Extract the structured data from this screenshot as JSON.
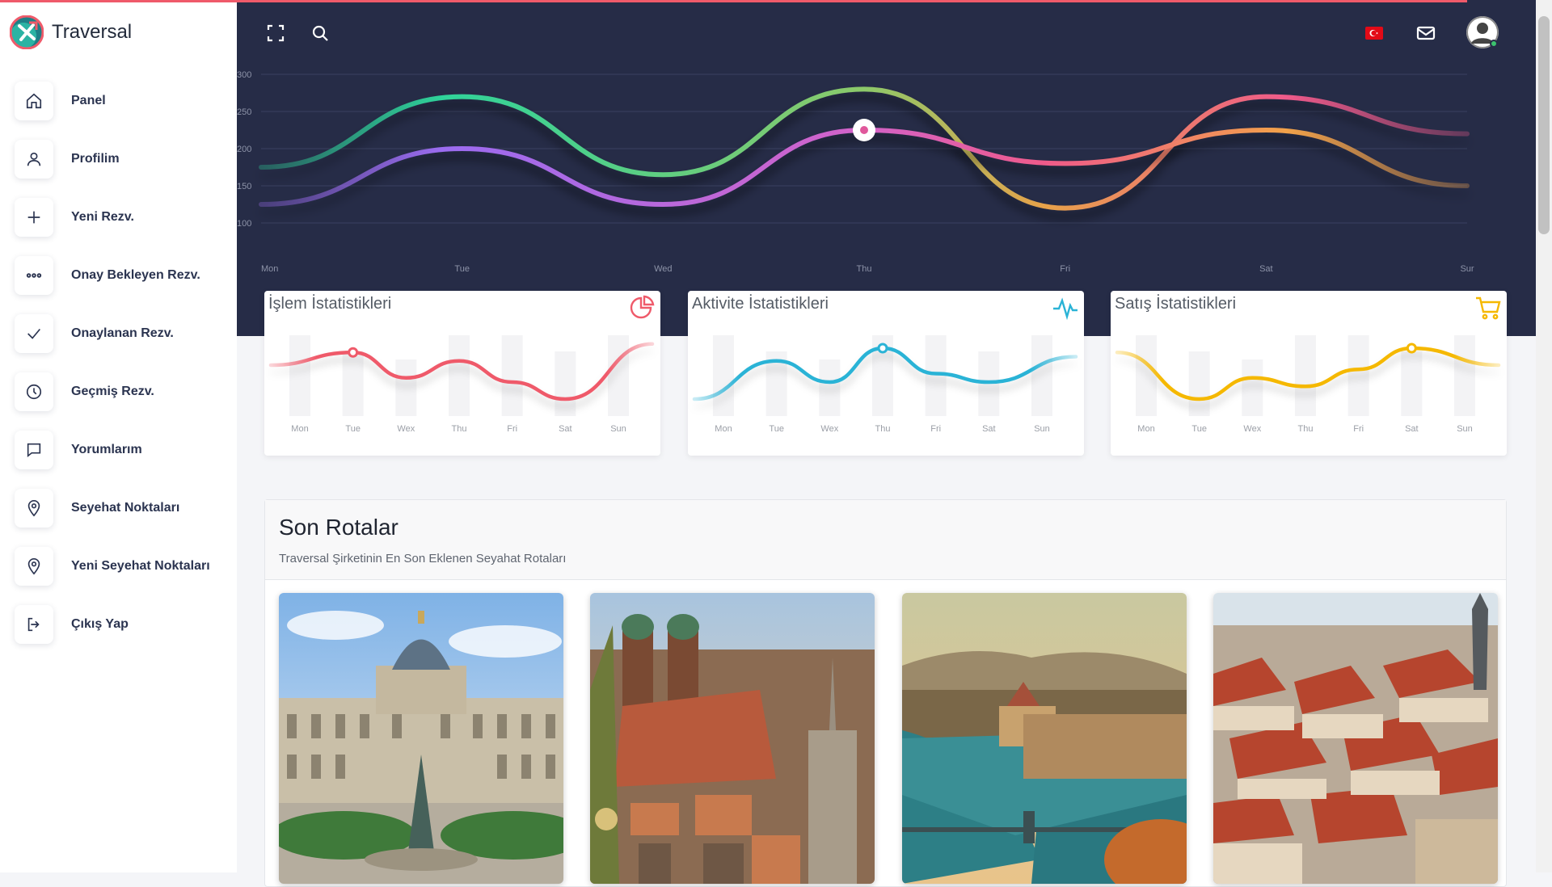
{
  "app": {
    "name": "Traversal"
  },
  "sidebar": {
    "items": [
      {
        "label": "Panel",
        "icon": "home-icon"
      },
      {
        "label": "Profilim",
        "icon": "user-icon"
      },
      {
        "label": "Yeni Rezv.",
        "icon": "plus-icon"
      },
      {
        "label": "Onay Bekleyen Rezv.",
        "icon": "more-dots-icon"
      },
      {
        "label": "Onaylanan Rezv.",
        "icon": "check-icon"
      },
      {
        "label": "Geçmiş Rezv.",
        "icon": "clock-icon"
      },
      {
        "label": "Yorumlarım",
        "icon": "message-icon"
      },
      {
        "label": "Seyehat Noktaları",
        "icon": "map-pin-icon"
      },
      {
        "label": "Yeni Seyehat Noktaları",
        "icon": "map-pin-icon"
      },
      {
        "label": "Çıkış Yap",
        "icon": "logout-icon"
      }
    ]
  },
  "topbar": {
    "icons": [
      "fullscreen-icon",
      "search-icon",
      "turkey-flag-icon",
      "mail-icon",
      "avatar"
    ]
  },
  "colors": {
    "dark_bg": "#262c47",
    "accent": "#ef5a6a",
    "green": "#2fd39a",
    "purple": "#b56be0",
    "pink": "#ef5a8a",
    "cyan": "#2ab3d6",
    "yellow": "#f5b800"
  },
  "chart_data": [
    {
      "type": "line",
      "x": [
        "Mon",
        "Tue",
        "Wed",
        "Thu",
        "Fri",
        "Sat",
        "Sur"
      ],
      "yticks": [
        100,
        150,
        200,
        250,
        300
      ],
      "ylim": [
        100,
        300
      ],
      "series": [
        {
          "values": [
            175,
            270,
            165,
            280,
            120,
            270,
            220
          ]
        },
        {
          "values": [
            125,
            200,
            125,
            225,
            180,
            225,
            150
          ]
        }
      ]
    },
    {
      "type": "line",
      "title": "İşlem İstatistikleri",
      "x": [
        "Mon",
        "Tue",
        "Wex",
        "Thu",
        "Fri",
        "Sat",
        "Sun"
      ],
      "series": [
        {
          "values": [
            60,
            75,
            45,
            65,
            40,
            20,
            85
          ]
        }
      ]
    },
    {
      "type": "line",
      "title": "Aktivite İstatistikleri",
      "x": [
        "Mon",
        "Tue",
        "Wex",
        "Thu",
        "Fri",
        "Sat",
        "Sun"
      ],
      "series": [
        {
          "values": [
            20,
            65,
            40,
            80,
            50,
            40,
            70
          ]
        }
      ]
    },
    {
      "type": "line",
      "title": "Satış İstatistikleri",
      "x": [
        "Mon",
        "Tue",
        "Wex",
        "Thu",
        "Fri",
        "Sat",
        "Sun"
      ],
      "series": [
        {
          "values": [
            75,
            20,
            45,
            35,
            55,
            80,
            60
          ]
        }
      ]
    }
  ],
  "routes": {
    "title": "Son Rotalar",
    "subtitle": "Traversal Şirketinin En Son Eklenen Seyahat Rotaları"
  }
}
